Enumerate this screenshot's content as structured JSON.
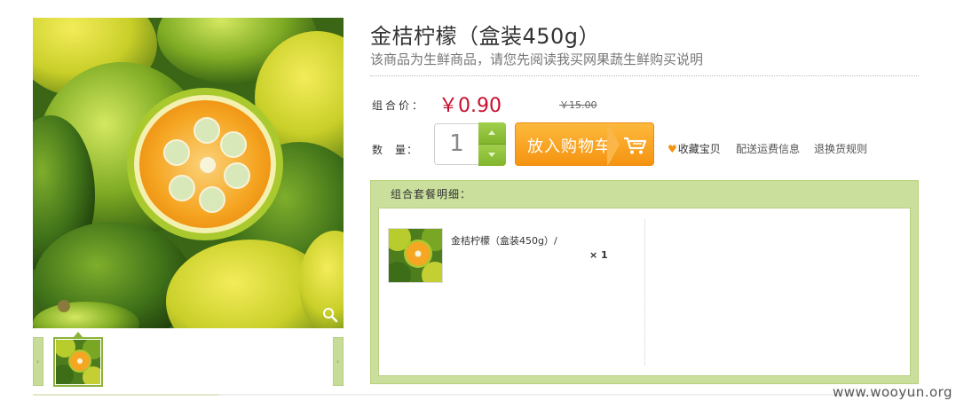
{
  "product": {
    "title": "金桔柠檬（盒装450g）",
    "notice": "该商品为生鲜商品，请您先阅读我买网果蔬生鲜购买说明"
  },
  "price": {
    "label": "组合价：",
    "current": "￥0.90",
    "original": "￥15.00"
  },
  "quantity": {
    "label": "数　量：",
    "value": "1"
  },
  "actions": {
    "add_to_cart": "放入购物车",
    "favorite": "收藏宝贝",
    "shipping_info": "配送运费信息",
    "return_policy": "退换货规则"
  },
  "combo": {
    "title": "组合套餐明细：",
    "items": [
      {
        "name": "金桔柠檬（盒装450g）/",
        "qty": "× 1"
      }
    ]
  },
  "watermark": "www.wooyun.org",
  "icons": {
    "zoom": "magnifier-icon",
    "cart": "shopping-cart-icon",
    "heart": "heart-icon",
    "stepper_up": "caret-up-icon",
    "stepper_down": "caret-down-icon",
    "thumb_prev": "chevron-left-icon",
    "thumb_next": "chevron-right-icon"
  },
  "colors": {
    "price_red": "#c8102e",
    "cart_orange": "#f59312",
    "stepper_green": "#8bc034",
    "panel_green": "#c9df9b"
  }
}
